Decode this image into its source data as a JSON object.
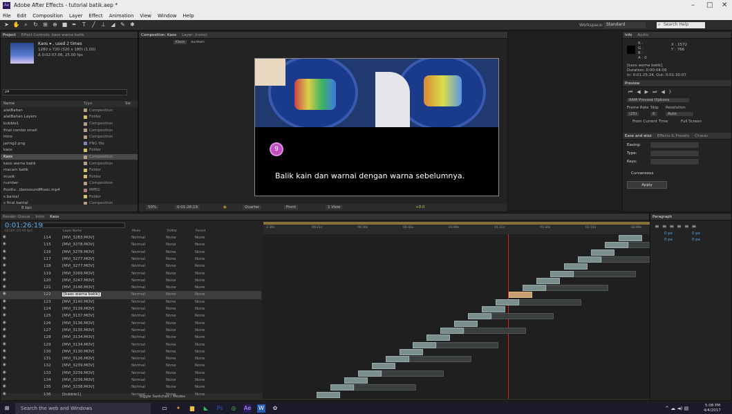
{
  "window": {
    "title": "Adobe After Effects - tutorial batik.aep *",
    "app_badge": "Ae"
  },
  "menu": [
    "File",
    "Edit",
    "Composition",
    "Layer",
    "Effect",
    "Animation",
    "View",
    "Window",
    "Help"
  ],
  "toolbar": {
    "workspace_label": "Workspace:",
    "workspace_value": "Standard",
    "search_help": "Search Help"
  },
  "project": {
    "tabs": [
      "Project",
      "Effect Controls: kaos warna batik"
    ],
    "selected_name": "Kaos ▾ , used 2 times",
    "selected_info1": "1280 x 720 (320 x 180) (1.00)",
    "selected_info2": "Δ 0:02:07:06, 25.00 fps",
    "search_placeholder": "ρ▾",
    "col_name": "Name",
    "col_type": "Type",
    "col_size": "Siz",
    "items": [
      {
        "name": "alatBahan",
        "type": "Composition",
        "color": "#b0a080"
      },
      {
        "name": "alatBahan Layers",
        "type": "Folder",
        "color": "#d8c060"
      },
      {
        "name": "bubble1",
        "type": "Composition",
        "color": "#b0a080"
      },
      {
        "name": "final combo small",
        "type": "Composition",
        "color": "#b0a080"
      },
      {
        "name": "Intro",
        "type": "Composition",
        "color": "#b0a080"
      },
      {
        "name": "jaring2.png",
        "type": "PNG file",
        "color": "#8080c0"
      },
      {
        "name": "kaos",
        "type": "Folder",
        "color": "#d8c060"
      },
      {
        "name": "Kaos",
        "type": "Composition",
        "color": "#b0a080"
      },
      {
        "name": "kaos warna batik",
        "type": "Composition",
        "color": "#b0a080"
      },
      {
        "name": "macam batik",
        "type": "Folder",
        "color": "#d8c060"
      },
      {
        "name": "musik",
        "type": "Folder",
        "color": "#d8c060"
      },
      {
        "name": "number",
        "type": "Composition",
        "color": "#b0a080"
      },
      {
        "name": "Positiv...(bensoundMusic.mp4",
        "type": "MPEG",
        "color": "#b08080"
      },
      {
        "name": "s bantal",
        "type": "Folder",
        "color": "#d8c060"
      },
      {
        "name": "s final bantal",
        "type": "Composition",
        "color": "#b0a080"
      }
    ],
    "bpc": "8 bpc"
  },
  "composition": {
    "tabs": [
      "Composition: Kaos",
      "Layer: (none)"
    ],
    "breadcrumb": [
      "Kaos",
      "sunken"
    ],
    "caption": "Balik kain dan warnai dengan warna sebelumnya.",
    "badge": "9",
    "zoom": "50%",
    "timecode": "0:01:26:19",
    "resolution": "Quarter",
    "view": "Front",
    "views": "1 View",
    "exposure": "+0.0"
  },
  "info": {
    "tabs": [
      "Info",
      "Audio"
    ],
    "r": "R :",
    "g": "G :",
    "b": "B :",
    "a": "A : 0",
    "x": "X : 1572",
    "y": "Y : 766",
    "layer": "[kaos warna batik]",
    "duration": "Duration: 0:00:04:09",
    "inout": "In: 0:01:25:24, Out: 0:01:30:07"
  },
  "preview": {
    "title": "Preview",
    "ram": "RAM Preview Options",
    "frame_rate": "Frame Rate",
    "skip": "Skip",
    "resolution": "Resolution",
    "fr_val": "(25)",
    "skip_val": "0",
    "res_val": "Auto",
    "from_current": "From Current Time",
    "full_screen": "Full Screen"
  },
  "ease": {
    "tabs": [
      "Ease and wizz",
      "Effects & Presets",
      "Charac"
    ],
    "easing": "Easing:",
    "type": "Type:",
    "keys": "Keys:",
    "curvaceous": "Curvaceous",
    "apply": "Apply"
  },
  "timeline": {
    "tabs": [
      "Render Queue",
      "Intro",
      "Kaos"
    ],
    "timecode": "0:01:26:19",
    "frames": "02169 (25.00 fps)",
    "col_layer": "Layer Name",
    "col_mode": "Mode",
    "col_trkmat": "TrkMat",
    "col_parent": "Parent",
    "ruler": [
      "1:30s",
      "00:21s",
      "00:30s",
      "00:41s",
      "01:00s",
      "01:21s",
      "01:30s",
      "01:51s",
      "02:00s"
    ],
    "toggle": "Toggle Switches / Modes",
    "layers": [
      {
        "num": "114",
        "name": "[MVI_3283.MOV]"
      },
      {
        "num": "115",
        "name": "[MVI_3278.MOV]"
      },
      {
        "num": "116",
        "name": "[MVI_3278.MOV]"
      },
      {
        "num": "117",
        "name": "[MVI_3277.MOV]"
      },
      {
        "num": "118",
        "name": "[MVI_3277.MOV]"
      },
      {
        "num": "119",
        "name": "[MVI_3269.MOV]"
      },
      {
        "num": "120",
        "name": "[MVI_3247.MOV]"
      },
      {
        "num": "121",
        "name": "[MVI_3146.MOV]"
      },
      {
        "num": "122",
        "name": "[kaos warna batik]"
      },
      {
        "num": "123",
        "name": "[MVI_3140.MOV]"
      },
      {
        "num": "124",
        "name": "[MVI_3139.MOV]"
      },
      {
        "num": "125",
        "name": "[MVI_3137.MOV]"
      },
      {
        "num": "126",
        "name": "[MVI_3136.MOV]"
      },
      {
        "num": "127",
        "name": "[MVI_3135.MOV]"
      },
      {
        "num": "128",
        "name": "[MVI_3134.MOV]"
      },
      {
        "num": "129",
        "name": "[MVI_3134.MOV]"
      },
      {
        "num": "130",
        "name": "[MVI_3130.MOV]"
      },
      {
        "num": "131",
        "name": "[MVI_3126.MOV]"
      },
      {
        "num": "132",
        "name": "[MVI_3239.MOV]"
      },
      {
        "num": "133",
        "name": "[MVI_3239.MOV]"
      },
      {
        "num": "134",
        "name": "[MVI_3239.MOV]"
      },
      {
        "num": "135",
        "name": "[MVI_3238.MOV]"
      },
      {
        "num": "136",
        "name": "[bubble1]"
      }
    ],
    "mode": "Normal",
    "trkmat": "None",
    "parent": "None"
  },
  "paragraph": {
    "title": "Paragraph",
    "px": "0 px"
  },
  "taskbar": {
    "search": "Search the web and Windows",
    "time": "5:08 PM",
    "date": "4/4/2017"
  }
}
